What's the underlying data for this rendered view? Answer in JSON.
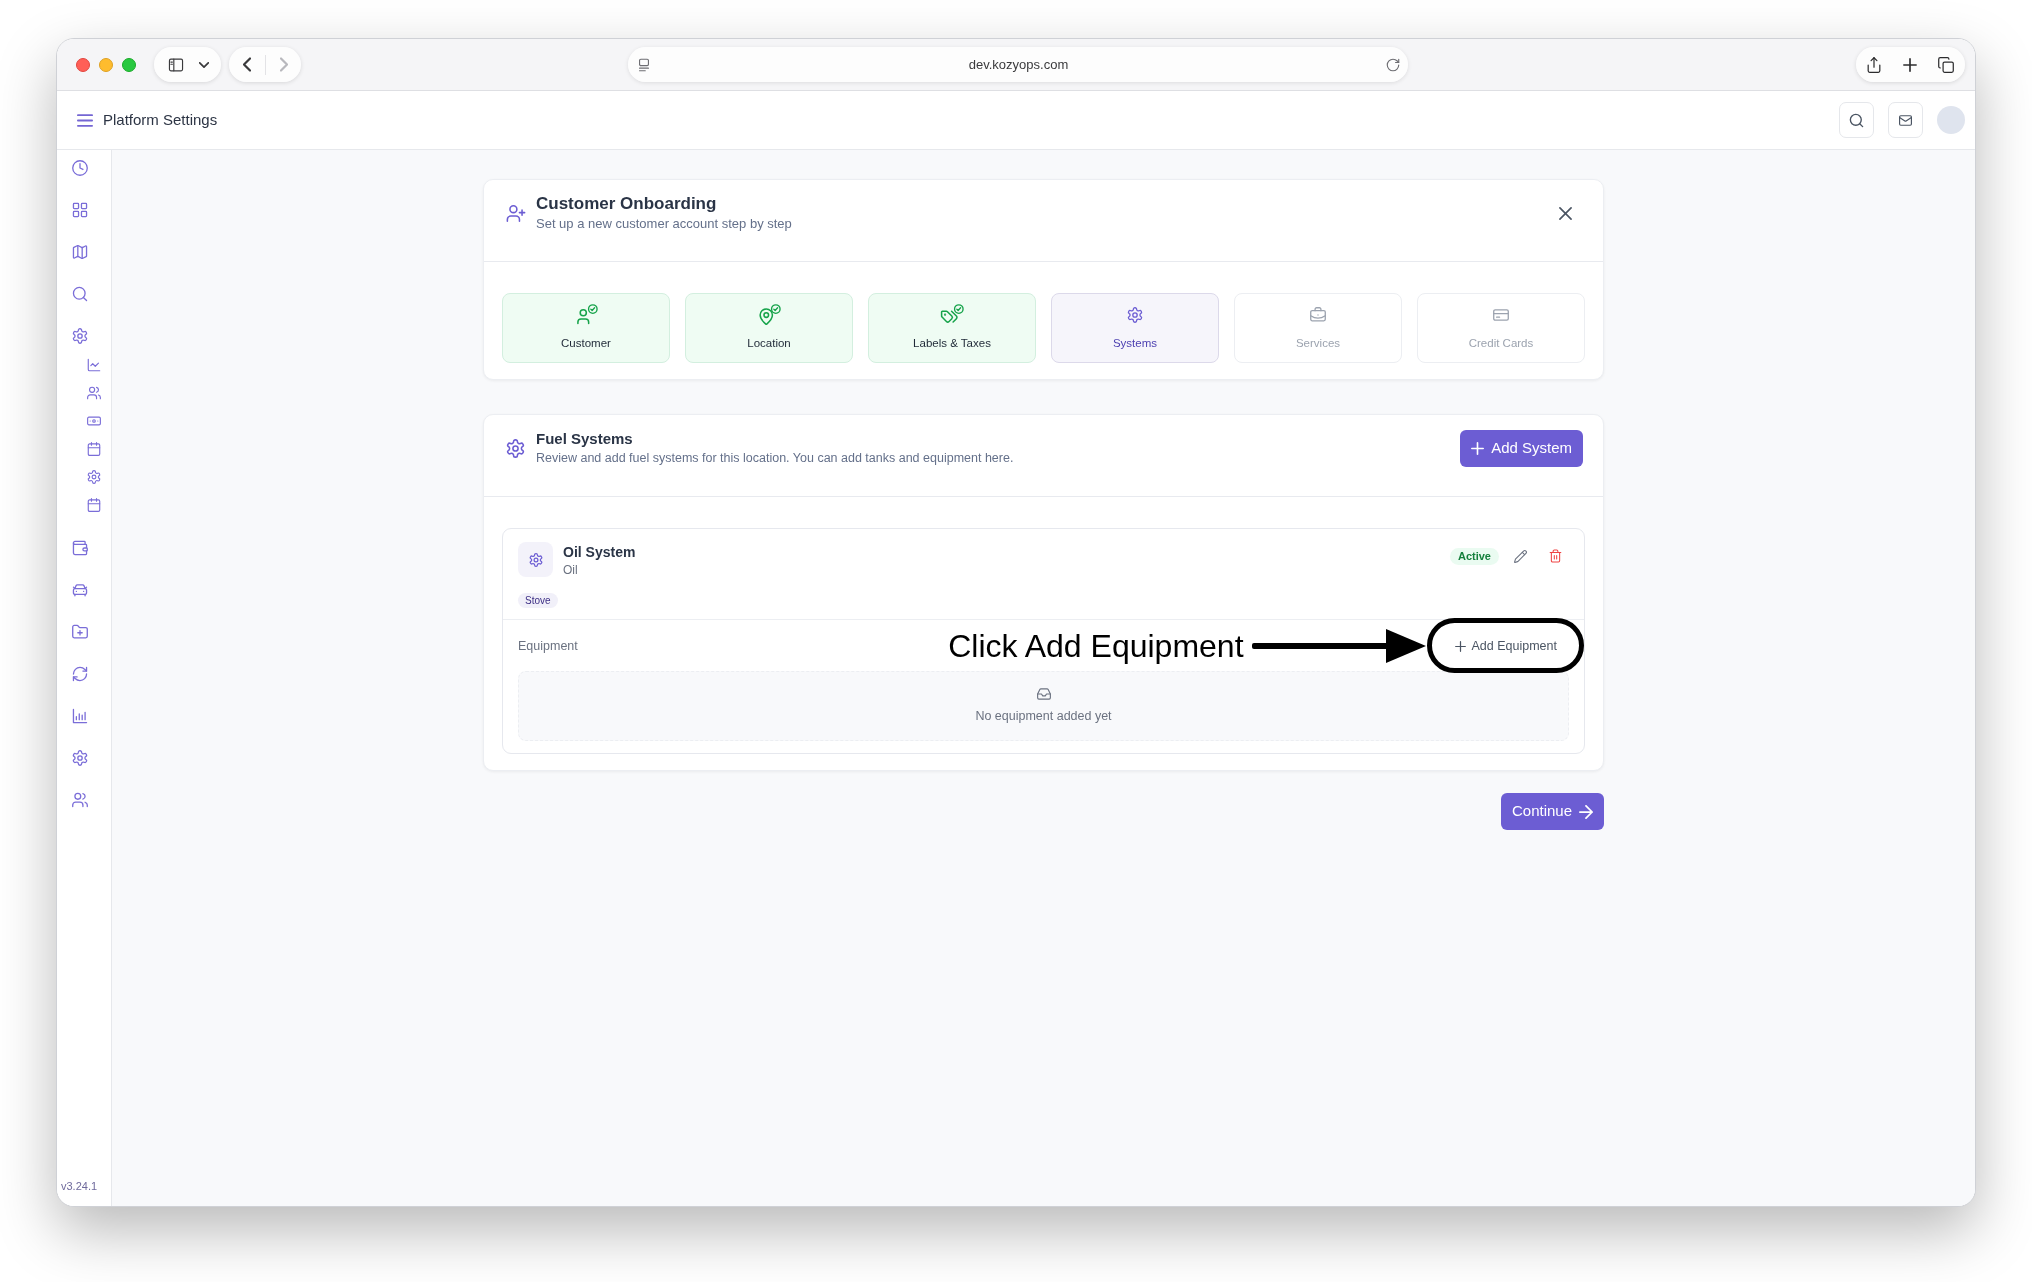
{
  "browser": {
    "url": "dev.kozyops.com",
    "forward_disabled": true
  },
  "app_header": {
    "title": "Platform Settings"
  },
  "sidebar": {
    "version": "v3.24.1"
  },
  "onboarding": {
    "title": "Customer Onboarding",
    "subtitle": "Set up a new customer account step by step",
    "steps": [
      {
        "label": "Customer",
        "completed": true,
        "selected": false
      },
      {
        "label": "Location",
        "completed": true,
        "selected": false
      },
      {
        "label": "Labels & Taxes",
        "completed": true,
        "selected": false
      },
      {
        "label": "Systems",
        "completed": false,
        "selected": true
      },
      {
        "label": "Services",
        "completed": false,
        "selected": false
      },
      {
        "label": "Credit Cards",
        "completed": false,
        "selected": false
      }
    ]
  },
  "fuel_systems": {
    "title": "Fuel Systems",
    "subtitle": "Review and add fuel systems for this location. You can add tanks and equipment here.",
    "add_button": "Add System",
    "systems": [
      {
        "name": "Oil System",
        "type": "Oil",
        "status": "Active",
        "tags": [
          "Stove"
        ],
        "equipment": {
          "label": "Equipment",
          "add_button": "Add Equipment",
          "empty_text": "No equipment added yet"
        }
      }
    ]
  },
  "continue_button": "Continue",
  "annotation": {
    "text": "Click Add Equipment"
  }
}
